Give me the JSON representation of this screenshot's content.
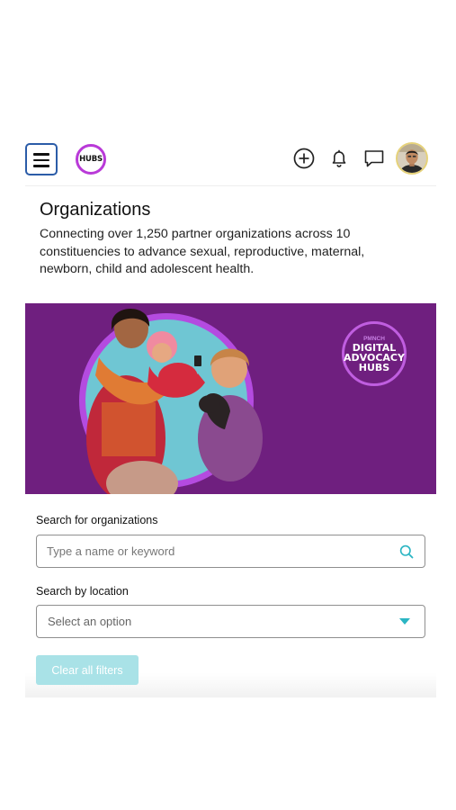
{
  "header": {
    "logo_text": "HUBS",
    "menu_icon": "hamburger-menu-icon",
    "action_icons": [
      "plus-circle-icon",
      "bell-icon",
      "chat-bubble-icon"
    ],
    "avatar": "user-avatar"
  },
  "page": {
    "title": "Organizations",
    "description": "Connecting over 1,250 partner organizations across 10 constituencies to advance sexual, reproductive, maternal, newborn, child and adolescent health."
  },
  "hero": {
    "badge_small": "PMNCH",
    "badge_lines": [
      "DIGITAL",
      "ADVOCACY",
      "HUBS"
    ],
    "background_color": "#6f1f7f",
    "ring_color": "#b44be0"
  },
  "search": {
    "org_label": "Search for organizations",
    "org_placeholder": "Type a name or keyword",
    "org_icon": "search-icon",
    "location_label": "Search by location",
    "location_value": "Select an option",
    "location_icon": "caret-down-icon",
    "clear_label": "Clear all filters",
    "accent_color": "#2bb5c3"
  }
}
